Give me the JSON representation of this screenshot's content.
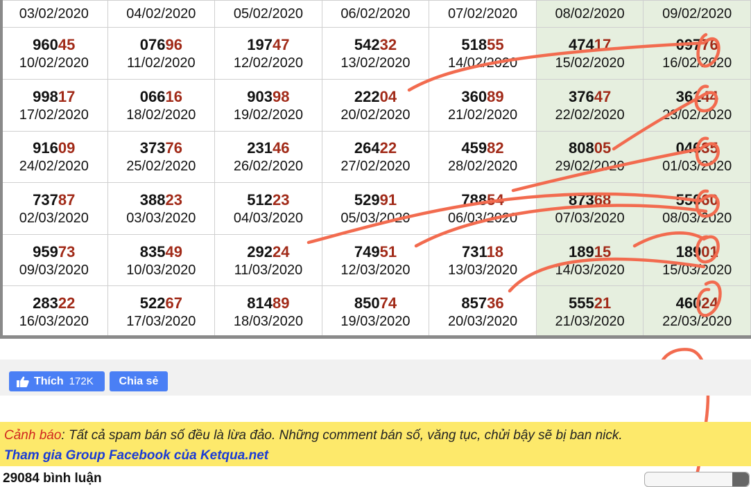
{
  "header_dates": [
    "03/02/2020",
    "04/02/2020",
    "05/02/2020",
    "06/02/2020",
    "07/02/2020",
    "08/02/2020",
    "09/02/2020"
  ],
  "rows": [
    [
      {
        "head": "960",
        "tail": "45",
        "date": "10/02/2020"
      },
      {
        "head": "076",
        "tail": "96",
        "date": "11/02/2020"
      },
      {
        "head": "197",
        "tail": "47",
        "date": "12/02/2020"
      },
      {
        "head": "542",
        "tail": "32",
        "date": "13/02/2020"
      },
      {
        "head": "518",
        "tail": "55",
        "date": "14/02/2020"
      },
      {
        "head": "474",
        "tail": "17",
        "date": "15/02/2020"
      },
      {
        "head": "097",
        "tail": "76",
        "date": "16/02/2020"
      }
    ],
    [
      {
        "head": "998",
        "tail": "17",
        "date": "17/02/2020"
      },
      {
        "head": "066",
        "tail": "16",
        "date": "18/02/2020"
      },
      {
        "head": "903",
        "tail": "98",
        "date": "19/02/2020"
      },
      {
        "head": "222",
        "tail": "04",
        "date": "20/02/2020"
      },
      {
        "head": "360",
        "tail": "89",
        "date": "21/02/2020"
      },
      {
        "head": "376",
        "tail": "47",
        "date": "22/02/2020"
      },
      {
        "head": "361",
        "tail": "44",
        "date": "23/02/2020"
      }
    ],
    [
      {
        "head": "916",
        "tail": "09",
        "date": "24/02/2020"
      },
      {
        "head": "373",
        "tail": "76",
        "date": "25/02/2020"
      },
      {
        "head": "231",
        "tail": "46",
        "date": "26/02/2020"
      },
      {
        "head": "264",
        "tail": "22",
        "date": "27/02/2020"
      },
      {
        "head": "459",
        "tail": "82",
        "date": "28/02/2020"
      },
      {
        "head": "808",
        "tail": "05",
        "date": "29/02/2020"
      },
      {
        "head": "046",
        "tail": "35",
        "date": "01/03/2020"
      }
    ],
    [
      {
        "head": "737",
        "tail": "87",
        "date": "02/03/2020"
      },
      {
        "head": "388",
        "tail": "23",
        "date": "03/03/2020"
      },
      {
        "head": "512",
        "tail": "23",
        "date": "04/03/2020"
      },
      {
        "head": "529",
        "tail": "91",
        "date": "05/03/2020"
      },
      {
        "head": "788",
        "tail": "54",
        "date": "06/03/2020"
      },
      {
        "head": "873",
        "tail": "68",
        "date": "07/03/2020"
      },
      {
        "head": "550",
        "tail": "60",
        "date": "08/03/2020"
      }
    ],
    [
      {
        "head": "959",
        "tail": "73",
        "date": "09/03/2020"
      },
      {
        "head": "835",
        "tail": "49",
        "date": "10/03/2020"
      },
      {
        "head": "292",
        "tail": "24",
        "date": "11/03/2020"
      },
      {
        "head": "749",
        "tail": "51",
        "date": "12/03/2020"
      },
      {
        "head": "731",
        "tail": "18",
        "date": "13/03/2020"
      },
      {
        "head": "189",
        "tail": "15",
        "date": "14/03/2020"
      },
      {
        "head": "189",
        "tail": "01",
        "date": "15/03/2020"
      }
    ],
    [
      {
        "head": "283",
        "tail": "22",
        "date": "16/03/2020"
      },
      {
        "head": "522",
        "tail": "67",
        "date": "17/03/2020"
      },
      {
        "head": "814",
        "tail": "89",
        "date": "18/03/2020"
      },
      {
        "head": "850",
        "tail": "74",
        "date": "19/03/2020"
      },
      {
        "head": "857",
        "tail": "36",
        "date": "20/03/2020"
      },
      {
        "head": "555",
        "tail": "21",
        "date": "21/03/2020"
      },
      {
        "head": "460",
        "tail": "24",
        "date": "22/03/2020"
      }
    ]
  ],
  "share": {
    "like_label": "Thích",
    "like_count": "172K",
    "share_label": "Chia sẻ"
  },
  "warning": {
    "label": "Cảnh báo",
    "text": ": Tất cả spam bán số đều là lừa đảo. Những comment bán số, văng tục, chửi bậy sẽ bị ban nick.",
    "link": "Tham gia Group Facebook của Ketqua.net"
  },
  "comments": {
    "count_text": "29084 bình luận"
  },
  "colors": {
    "tail_digits": "#a12a18",
    "weekend_column": "#e6efdf",
    "annotation_ink": "#f26b4f",
    "warning_bg": "#fde96b"
  }
}
